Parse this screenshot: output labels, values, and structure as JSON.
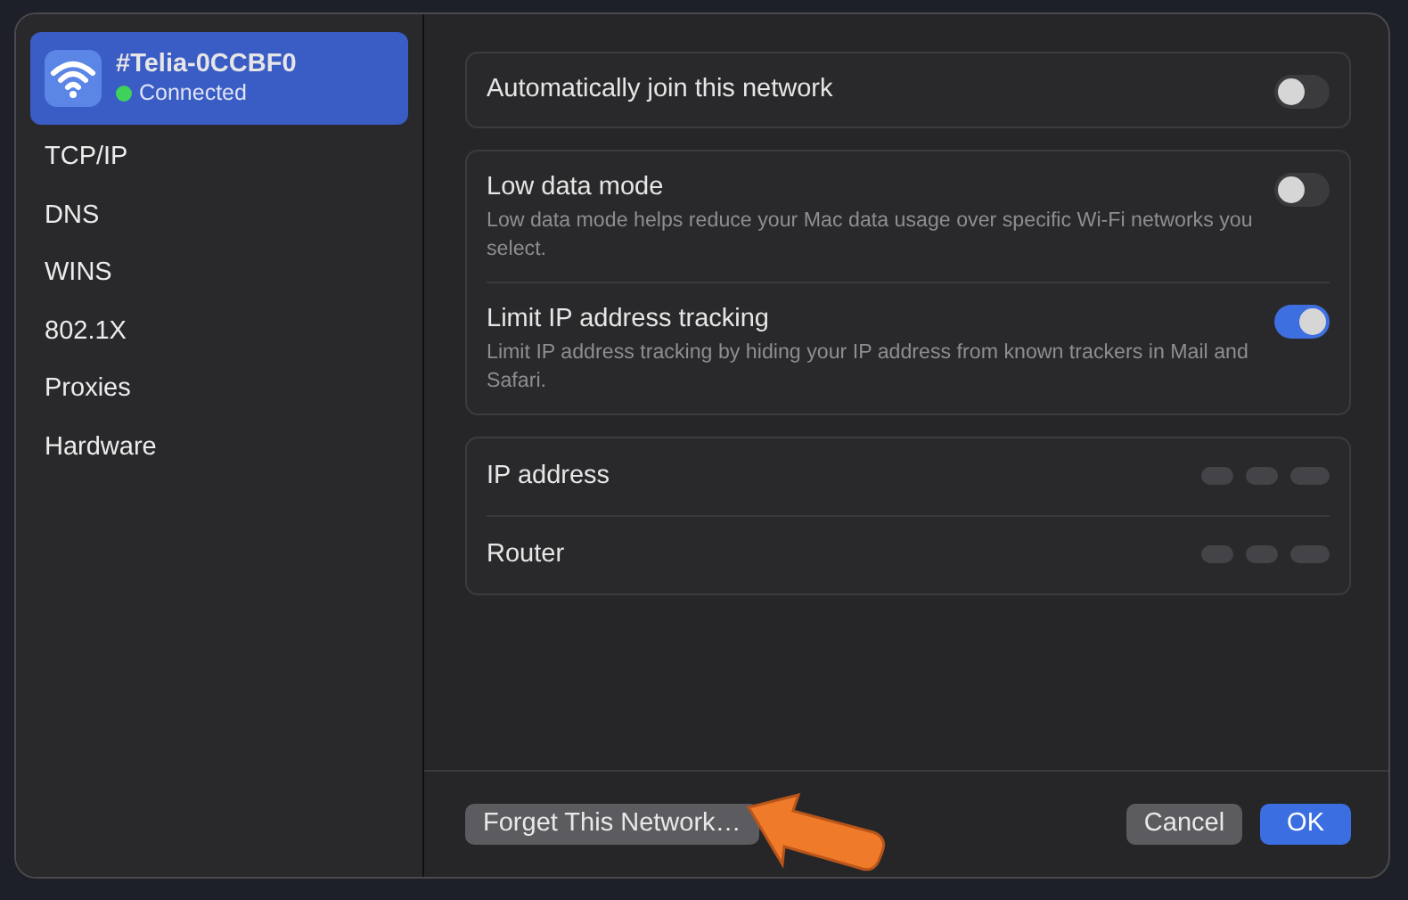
{
  "sidebar": {
    "network": {
      "name": "#Telia-0CCBF0",
      "status": "Connected",
      "connected": true,
      "selected": true
    },
    "items": [
      {
        "label": "TCP/IP",
        "selected": false
      },
      {
        "label": "DNS",
        "selected": false
      },
      {
        "label": "WINS",
        "selected": false
      },
      {
        "label": "802.1X",
        "selected": false
      },
      {
        "label": "Proxies",
        "selected": false
      },
      {
        "label": "Hardware",
        "selected": false
      }
    ]
  },
  "groups": [
    {
      "rows": [
        {
          "kind": "toggle",
          "label": "Automatically join this network",
          "on": false
        }
      ]
    },
    {
      "rows": [
        {
          "kind": "toggle",
          "label": "Low data mode",
          "description": "Low data mode helps reduce your Mac data usage over specific Wi-Fi networks you select.",
          "on": false
        },
        {
          "kind": "toggle",
          "label": "Limit IP address tracking",
          "description": "Limit IP address tracking by hiding your IP address from known trackers in Mail and Safari.",
          "on": true
        }
      ]
    },
    {
      "rows": [
        {
          "kind": "info",
          "label": "IP address"
        },
        {
          "kind": "info",
          "label": "Router"
        }
      ]
    }
  ],
  "footer": {
    "forget_button": "Forget This Network…",
    "cancel_button": "Cancel",
    "ok_button": "OK"
  }
}
